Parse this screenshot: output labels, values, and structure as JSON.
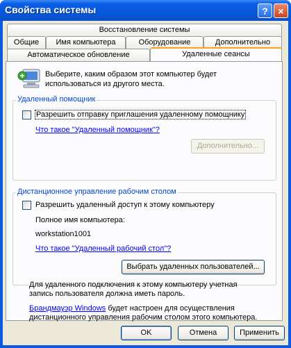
{
  "window": {
    "title": "Свойства системы",
    "help_icon": "?",
    "close_icon": "×"
  },
  "tabs": {
    "row1": [
      "Восстановление системы"
    ],
    "row2": [
      "Общие",
      "Имя компьютера",
      "Оборудование",
      "Дополнительно"
    ],
    "row3": [
      "Автоматическое обновление",
      "Удаленные сеансы"
    ],
    "active": "Удаленные сеансы"
  },
  "intro": {
    "line1": "Выберите, каким образом этот компьютер будет",
    "line2": "использоваться из другого места."
  },
  "assistance": {
    "group_label": "Удаленный помощник",
    "checkbox_label": "Разрешить отправку приглашения удаленному помощнику",
    "checked": false,
    "link": "Что такое \"Удаленный помощник\"?",
    "advanced_button": "Дополнительно..."
  },
  "desktop": {
    "group_label": "Дистанционное управление рабочим столом",
    "checkbox_label": "Разрешить удаленный доступ к этому компьютеру",
    "checked": false,
    "full_name_label": "Полное имя компьютера:",
    "full_name_value": "workstation1001",
    "link": "Что такое \"Удаленный рабочий стол\"?",
    "select_users_button": "Выбрать удаленных пользователей..."
  },
  "notes": {
    "para1_line1": "Для удаленного подключения к этому компьютеру учетная",
    "para1_line2": "запись пользователя должна иметь пароль.",
    "firewall_link": "Брандмауэр Windows",
    "para2_line1_rest": " будет настроен для осуществления",
    "para2_line2": "дистанционного управления рабочим столом этого компьютера."
  },
  "footer": {
    "ok": "OK",
    "cancel": "Отмена",
    "apply": "Применить"
  }
}
